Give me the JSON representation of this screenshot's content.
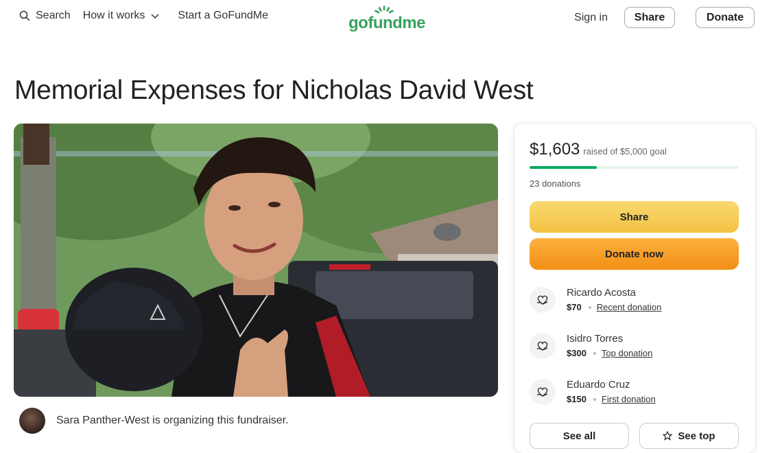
{
  "header": {
    "search_label": "Search",
    "how_it_works_label": "How it works",
    "start_label": "Start a GoFundMe",
    "logo_text": "gofundme",
    "sign_in_label": "Sign in",
    "share_label": "Share",
    "donate_label": "Donate"
  },
  "campaign": {
    "title": "Memorial Expenses for Nicholas David West",
    "organizer_text": "Sara Panther-West is organizing this fundraiser."
  },
  "donation_card": {
    "raised_amount": "$1,603",
    "goal_text": "raised of $5,000 goal",
    "progress_fraction": 0.32,
    "donations_count": "23 donations",
    "share_button": "Share",
    "donate_button": "Donate now",
    "donors": [
      {
        "name": "Ricardo Acosta",
        "amount": "$70",
        "tag": "Recent donation"
      },
      {
        "name": "Isidro Torres",
        "amount": "$300",
        "tag": "Top donation"
      },
      {
        "name": "Eduardo Cruz",
        "amount": "$150",
        "tag": "First donation"
      }
    ],
    "see_all_label": "See all",
    "see_top_label": "See top"
  },
  "colors": {
    "brand_green": "#36a35e",
    "progress_green": "#02a95c",
    "share_yellow": "#f2c243",
    "donate_orange": "#f38e16"
  },
  "icons": [
    "search-icon",
    "chevron-down-icon",
    "heart-hand-icon",
    "star-icon"
  ]
}
